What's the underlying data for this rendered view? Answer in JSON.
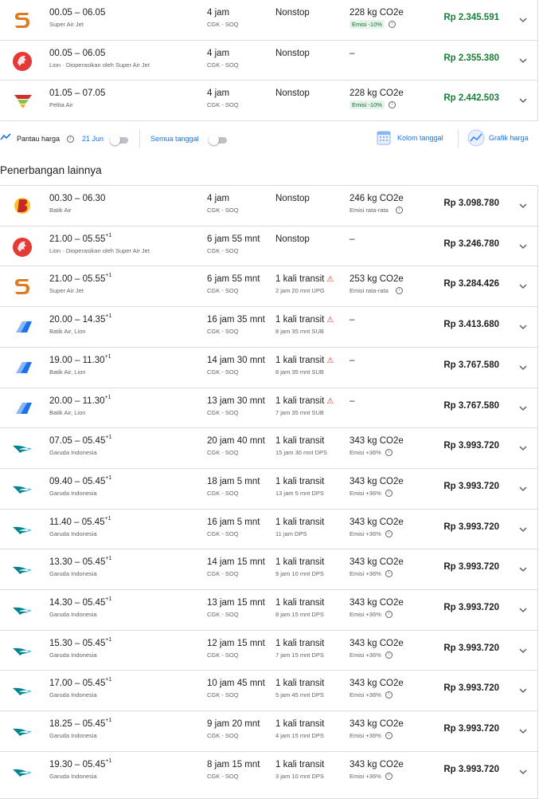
{
  "top_flights": [
    {
      "time": "00.05 – 06.05",
      "plus": "",
      "airline": "Super Air Jet",
      "duration": "4 jam",
      "route": "CGK - SOQ",
      "stops": "Nonstop",
      "stop_detail": "",
      "warn": false,
      "co2": "228 kg CO2e",
      "co2_note": "Emisi -10%",
      "co2_badge": true,
      "price": "Rp 2.345.591",
      "price_green": true,
      "logo": "superairjet-logo-icon"
    },
    {
      "time": "00.05 – 06.05",
      "plus": "",
      "airline": "Lion · Dioperasikan oleh Super Air Jet",
      "duration": "4 jam",
      "route": "CGK - SOQ",
      "stops": "Nonstop",
      "stop_detail": "",
      "warn": false,
      "co2": "–",
      "co2_note": "",
      "co2_badge": false,
      "price": "Rp 2.355.380",
      "price_green": true,
      "logo": "lion-logo-icon"
    },
    {
      "time": "01.05 – 07.05",
      "plus": "",
      "airline": "Pelita Air",
      "duration": "4 jam",
      "route": "CGK - SOQ",
      "stops": "Nonstop",
      "stop_detail": "",
      "warn": false,
      "co2": "228 kg CO2e",
      "co2_note": "Emisi -10%",
      "co2_badge": true,
      "price": "Rp 2.442.503",
      "price_green": true,
      "logo": "pelita-logo-icon"
    }
  ],
  "toolbar": {
    "track_prices": "Pantau harga",
    "date": "21 Jun",
    "all_dates": "Semua tanggal",
    "date_grid": "Kolom tanggal",
    "price_graph": "Grafik harga"
  },
  "section_title": "Penerbangan lainnya",
  "other_flights": [
    {
      "time": "00.30 – 06.30",
      "plus": "",
      "airline": "Batik Air",
      "duration": "4 jam",
      "route": "CGK - SOQ",
      "stops": "Nonstop",
      "stop_detail": "",
      "warn": false,
      "co2": "246 kg CO2e",
      "co2_note": "Emisi rata-rata",
      "co2_badge": false,
      "co2_info": true,
      "price": "Rp 3.098.780",
      "logo": "batik-logo-icon"
    },
    {
      "time": "21.00 – 05.55",
      "plus": "+1",
      "airline": "Lion · Dioperasikan oleh Super Air Jet",
      "duration": "6 jam 55 mnt",
      "route": "CGK - SOQ",
      "stops": "Nonstop",
      "stop_detail": "",
      "warn": false,
      "co2": "–",
      "co2_note": "",
      "co2_badge": false,
      "co2_info": false,
      "price": "Rp 3.246.780",
      "logo": "lion-logo-icon"
    },
    {
      "time": "21.00 – 05.55",
      "plus": "+1",
      "airline": "Super Air Jet",
      "duration": "6 jam 55 mnt",
      "route": "CGK - SOQ",
      "stops": "1 kali transit",
      "stop_detail": "2 jam 20 mnt UPG",
      "warn": true,
      "co2": "253 kg CO2e",
      "co2_note": "Emisi rata-rata",
      "co2_badge": false,
      "co2_info": true,
      "price": "Rp 3.284.426",
      "logo": "superairjet-logo-icon"
    },
    {
      "time": "20.00 – 14.35",
      "plus": "+1",
      "airline": "Batik Air, Lion",
      "duration": "16 jam 35 mnt",
      "route": "CGK - SOQ",
      "stops": "1 kali transit",
      "stop_detail": "8 jam 35 mnt SUB",
      "warn": true,
      "co2": "–",
      "co2_note": "",
      "co2_badge": false,
      "co2_info": false,
      "price": "Rp 3.413.680",
      "logo": "multi-airline-logo-icon"
    },
    {
      "time": "19.00 – 11.30",
      "plus": "+1",
      "airline": "Batik Air, Lion",
      "duration": "14 jam 30 mnt",
      "route": "CGK - SOQ",
      "stops": "1 kali transit",
      "stop_detail": "8 jam 35 mnt SUB",
      "warn": true,
      "co2": "–",
      "co2_note": "",
      "co2_badge": false,
      "co2_info": false,
      "price": "Rp 3.767.580",
      "logo": "multi-airline-logo-icon"
    },
    {
      "time": "20.00 – 11.30",
      "plus": "+1",
      "airline": "Batik Air, Lion",
      "duration": "13 jam 30 mnt",
      "route": "CGK - SOQ",
      "stops": "1 kali transit",
      "stop_detail": "7 jam 35 mnt SUB",
      "warn": true,
      "co2": "–",
      "co2_note": "",
      "co2_badge": false,
      "co2_info": false,
      "price": "Rp 3.767.580",
      "logo": "multi-airline-logo-icon"
    },
    {
      "time": "07.05 – 05.45",
      "plus": "+1",
      "airline": "Garuda Indonesia",
      "duration": "20 jam 40 mnt",
      "route": "CGK - SOQ",
      "stops": "1 kali transit",
      "stop_detail": "15 jam 30 mnt DPS",
      "warn": false,
      "co2": "343 kg CO2e",
      "co2_note": "Emisi +36%",
      "co2_badge": false,
      "co2_info": true,
      "price": "Rp 3.993.720",
      "logo": "garuda-logo-icon"
    },
    {
      "time": "09.40 – 05.45",
      "plus": "+1",
      "airline": "Garuda Indonesia",
      "duration": "18 jam 5 mnt",
      "route": "CGK - SOQ",
      "stops": "1 kali transit",
      "stop_detail": "13 jam 5 mnt DPS",
      "warn": false,
      "co2": "343 kg CO2e",
      "co2_note": "Emisi +36%",
      "co2_badge": false,
      "co2_info": true,
      "price": "Rp 3.993.720",
      "logo": "garuda-logo-icon"
    },
    {
      "time": "11.40 – 05.45",
      "plus": "+1",
      "airline": "Garuda Indonesia",
      "duration": "16 jam 5 mnt",
      "route": "CGK - SOQ",
      "stops": "1 kali transit",
      "stop_detail": "11 jam DPS",
      "warn": false,
      "co2": "343 kg CO2e",
      "co2_note": "Emisi +36%",
      "co2_badge": false,
      "co2_info": true,
      "price": "Rp 3.993.720",
      "logo": "garuda-logo-icon"
    },
    {
      "time": "13.30 – 05.45",
      "plus": "+1",
      "airline": "Garuda Indonesia",
      "duration": "14 jam 15 mnt",
      "route": "CGK - SOQ",
      "stops": "1 kali transit",
      "stop_detail": "9 jam 10 mnt DPS",
      "warn": false,
      "co2": "343 kg CO2e",
      "co2_note": "Emisi +36%",
      "co2_badge": false,
      "co2_info": true,
      "price": "Rp 3.993.720",
      "logo": "garuda-logo-icon"
    },
    {
      "time": "14.30 – 05.45",
      "plus": "+1",
      "airline": "Garuda Indonesia",
      "duration": "13 jam 15 mnt",
      "route": "CGK - SOQ",
      "stops": "1 kali transit",
      "stop_detail": "8 jam 15 mnt DPS",
      "warn": false,
      "co2": "343 kg CO2e",
      "co2_note": "Emisi +36%",
      "co2_badge": false,
      "co2_info": true,
      "price": "Rp 3.993.720",
      "logo": "garuda-logo-icon"
    },
    {
      "time": "15.30 – 05.45",
      "plus": "+1",
      "airline": "Garuda Indonesia",
      "duration": "12 jam 15 mnt",
      "route": "CGK - SOQ",
      "stops": "1 kali transit",
      "stop_detail": "7 jam 15 mnt DPS",
      "warn": false,
      "co2": "343 kg CO2e",
      "co2_note": "Emisi +36%",
      "co2_badge": false,
      "co2_info": true,
      "price": "Rp 3.993.720",
      "logo": "garuda-logo-icon"
    },
    {
      "time": "17.00 – 05.45",
      "plus": "+1",
      "airline": "Garuda Indonesia",
      "duration": "10 jam 45 mnt",
      "route": "CGK - SOQ",
      "stops": "1 kali transit",
      "stop_detail": "5 jam 45 mnt DPS",
      "warn": false,
      "co2": "343 kg CO2e",
      "co2_note": "Emisi +36%",
      "co2_badge": false,
      "co2_info": true,
      "price": "Rp 3.993.720",
      "logo": "garuda-logo-icon"
    },
    {
      "time": "18.25 – 05.45",
      "plus": "+1",
      "airline": "Garuda Indonesia",
      "duration": "9 jam 20 mnt",
      "route": "CGK - SOQ",
      "stops": "1 kali transit",
      "stop_detail": "4 jam 15 mnt DPS",
      "warn": false,
      "co2": "343 kg CO2e",
      "co2_note": "Emisi +36%",
      "co2_badge": false,
      "co2_info": true,
      "price": "Rp 3.993.720",
      "logo": "garuda-logo-icon"
    },
    {
      "time": "19.30 – 05.45",
      "plus": "+1",
      "airline": "Garuda Indonesia",
      "duration": "8 jam 15 mnt",
      "route": "CGK - SOQ",
      "stops": "1 kali transit",
      "stop_detail": "3 jam 10 mnt DPS",
      "warn": false,
      "co2": "343 kg CO2e",
      "co2_note": "Emisi +36%",
      "co2_badge": false,
      "co2_info": true,
      "price": "Rp 3.993.720",
      "logo": "garuda-logo-icon"
    }
  ],
  "colors": {
    "accent": "#1a73e8",
    "price_green": "#188038",
    "warning": "#d93025",
    "badge_bg": "#e6f4ea"
  }
}
